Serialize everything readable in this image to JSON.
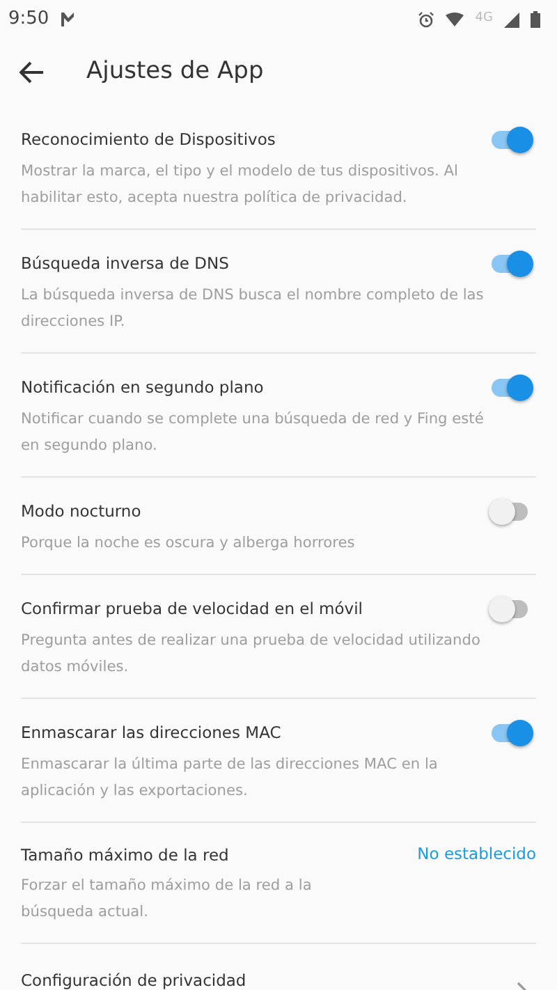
{
  "status_bar": {
    "time": "9:50",
    "network": "4G"
  },
  "app_bar": {
    "title": "Ajustes de App"
  },
  "settings": [
    {
      "kind": "toggle",
      "title": "Reconocimiento de Dispositivos",
      "description": "Mostrar la marca, el tipo y el modelo de tus dispositivos. Al habilitar esto, acepta nuestra política de privacidad.",
      "on": true
    },
    {
      "kind": "toggle",
      "title": "Búsqueda inversa de DNS",
      "description": "La búsqueda inversa de DNS busca el nombre completo de las direcciones IP.",
      "on": true
    },
    {
      "kind": "toggle",
      "title": "Notificación en segundo plano",
      "description": "Notificar cuando se complete una búsqueda de red y Fing esté en segundo plano.",
      "on": true
    },
    {
      "kind": "toggle",
      "title": "Modo nocturno",
      "description": "Porque la noche es oscura y alberga horrores",
      "on": false
    },
    {
      "kind": "toggle",
      "title": "Confirmar prueba de velocidad en el móvil",
      "description": "Pregunta antes de realizar una prueba de velocidad utilizando datos móviles.",
      "on": false
    },
    {
      "kind": "toggle",
      "title": "Enmascarar las direcciones MAC",
      "description": "Enmascarar la última parte de las direcciones MAC en la aplicación y las exportaciones.",
      "on": true
    },
    {
      "kind": "value",
      "title": "Tamaño máximo de la red",
      "description": "Forzar el tamaño máximo de la red a la búsqueda actual.",
      "value": "No establecido"
    },
    {
      "kind": "link",
      "title": "Configuración de privacidad"
    }
  ]
}
